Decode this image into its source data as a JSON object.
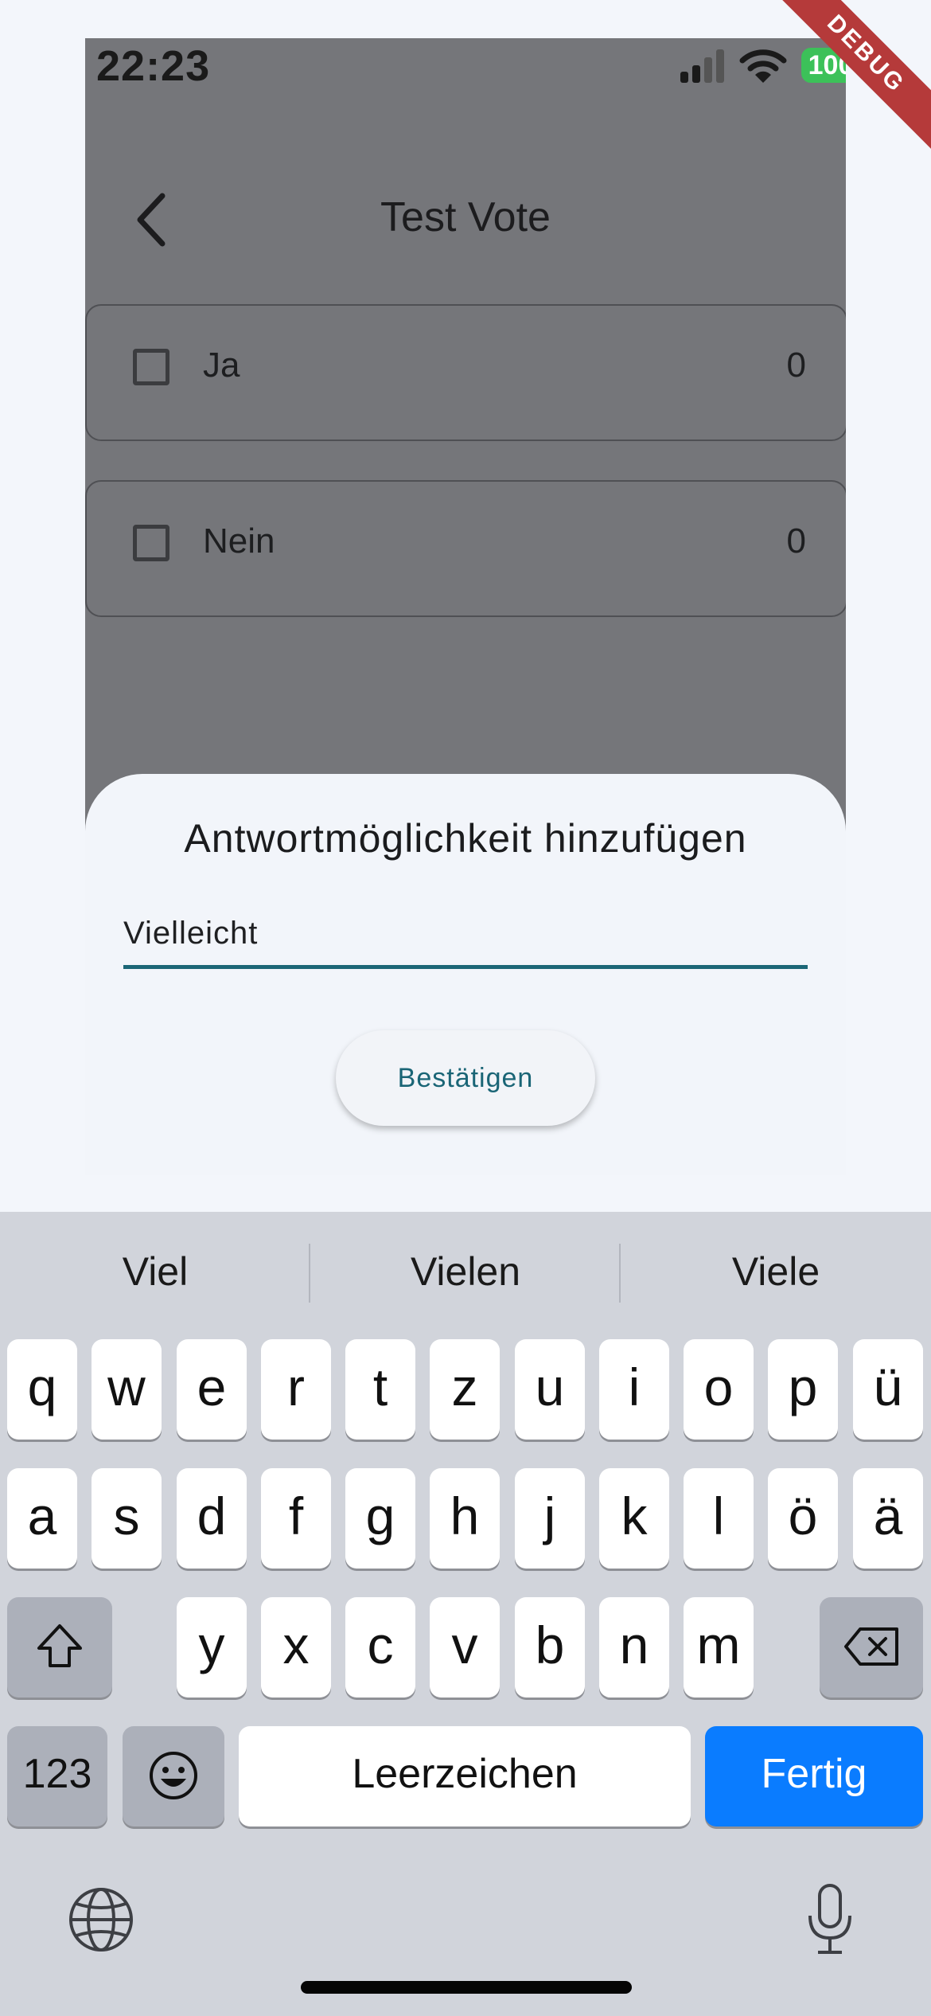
{
  "status_bar": {
    "time": "22:23",
    "battery": "100"
  },
  "debug_banner": "DEBUG",
  "app_bar": {
    "title": "Test Vote"
  },
  "options": [
    {
      "label": "Ja",
      "count": "0"
    },
    {
      "label": "Nein",
      "count": "0"
    }
  ],
  "sheet": {
    "title": "Antwortmöglichkeit hinzufügen",
    "input_value": "Vielleicht",
    "confirm_label": "Bestätigen"
  },
  "keyboard": {
    "suggestions": [
      "Viel",
      "Vielen",
      "Viele"
    ],
    "row1": [
      "q",
      "w",
      "e",
      "r",
      "t",
      "z",
      "u",
      "i",
      "o",
      "p",
      "ü"
    ],
    "row2": [
      "a",
      "s",
      "d",
      "f",
      "g",
      "h",
      "j",
      "k",
      "l",
      "ö",
      "ä"
    ],
    "row3": [
      "y",
      "x",
      "c",
      "v",
      "b",
      "n",
      "m"
    ],
    "numbers_label": "123",
    "space_label": "Leerzeichen",
    "done_label": "Fertig"
  },
  "colors": {
    "accent": "#1c6777",
    "done_key": "#0a7cff",
    "scrim": "#75767a"
  }
}
